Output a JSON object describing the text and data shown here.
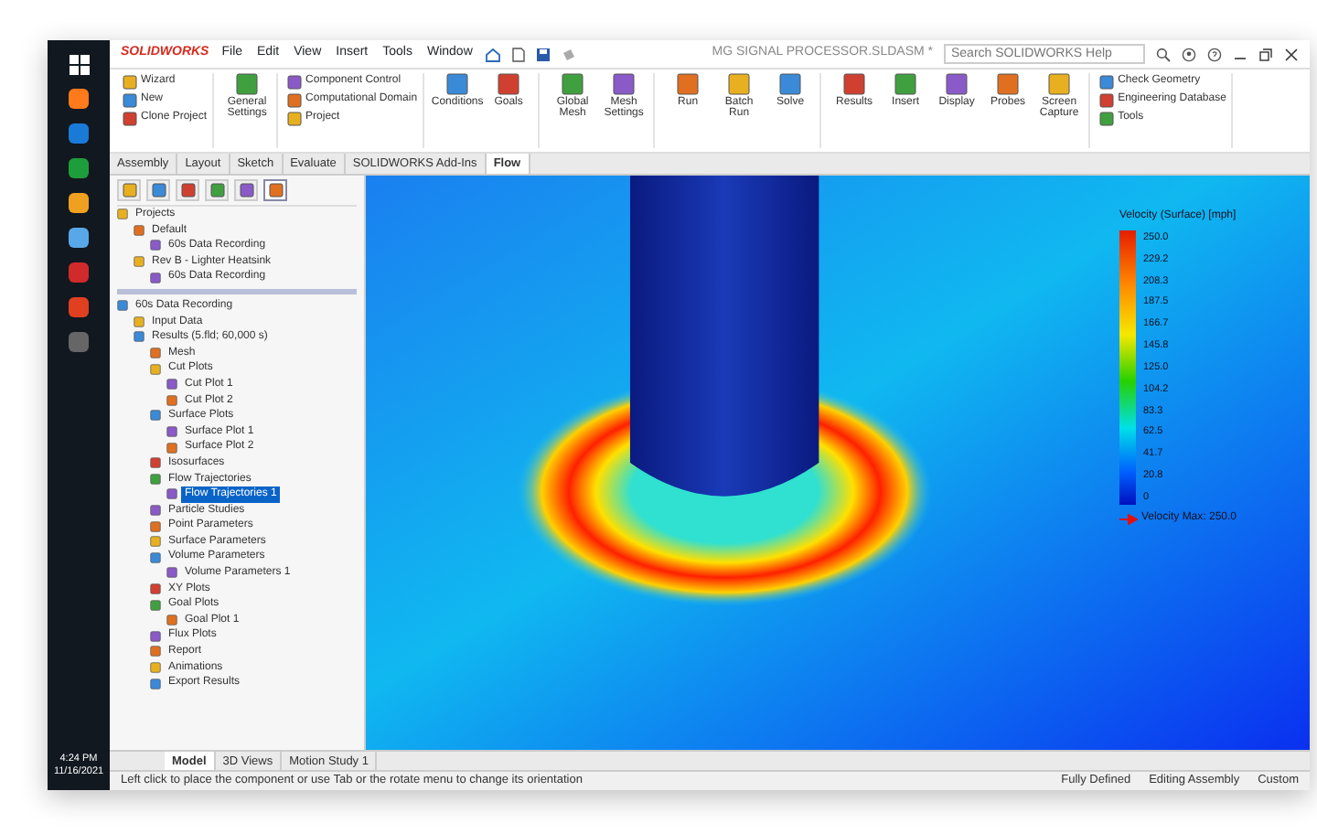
{
  "window": {
    "app_name": "SOLIDWORKS",
    "title": "MG SIGNAL PROCESSOR.SLDASM *",
    "menus": [
      "File",
      "Edit",
      "View",
      "Insert",
      "Tools",
      "Window"
    ],
    "search": {
      "placeholder": "Search SOLIDWORKS Help"
    }
  },
  "ribbon": [
    [
      {
        "kind": "small",
        "label": "Wizard"
      },
      {
        "kind": "small",
        "label": "New"
      },
      {
        "kind": "small",
        "label": "Clone Project"
      }
    ],
    [
      {
        "kind": "large",
        "label": "General Settings"
      }
    ],
    [
      {
        "kind": "small",
        "label": "Component Control"
      },
      {
        "kind": "small",
        "label": "Computational Domain"
      },
      {
        "kind": "small",
        "label": "Project"
      }
    ],
    [
      {
        "kind": "large",
        "label": "Conditions"
      },
      {
        "kind": "large",
        "label": "Goals"
      }
    ],
    [
      {
        "kind": "large",
        "label": "Global Mesh"
      },
      {
        "kind": "large",
        "label": "Mesh Settings"
      }
    ],
    [
      {
        "kind": "large",
        "label": "Run"
      },
      {
        "kind": "large",
        "label": "Batch Run"
      },
      {
        "kind": "large",
        "label": "Solve"
      }
    ],
    [
      {
        "kind": "large",
        "label": "Results"
      },
      {
        "kind": "large",
        "label": "Insert"
      },
      {
        "kind": "large",
        "label": "Display"
      },
      {
        "kind": "large",
        "label": "Probes"
      },
      {
        "kind": "large",
        "label": "Screen Capture"
      }
    ],
    [
      {
        "kind": "small",
        "label": "Check Geometry"
      },
      {
        "kind": "small",
        "label": "Engineering Database"
      },
      {
        "kind": "small",
        "label": "Tools"
      }
    ]
  ],
  "tabs": [
    {
      "label": "Assembly",
      "selected": false
    },
    {
      "label": "Layout",
      "selected": false
    },
    {
      "label": "Sketch",
      "selected": false
    },
    {
      "label": "Evaluate",
      "selected": false
    },
    {
      "label": "SOLIDWORKS Add-Ins",
      "selected": false
    },
    {
      "label": "Flow",
      "selected": true
    }
  ],
  "panel_tabs": [
    {
      "selected": false
    },
    {
      "selected": false
    },
    {
      "selected": false
    },
    {
      "selected": false
    },
    {
      "selected": false
    },
    {
      "selected": true
    }
  ],
  "project_tree": [
    {
      "label": "Projects",
      "selected": false,
      "children": [
        {
          "label": "Default",
          "selected": false,
          "children": [
            {
              "label": "60s Data Recording",
              "selected": false
            }
          ]
        },
        {
          "label": "Rev B - Lighter Heatsink",
          "selected": false,
          "children": [
            {
              "label": "60s Data Recording",
              "selected": false
            }
          ]
        }
      ]
    }
  ],
  "analysis_tree": [
    {
      "label": "60s Data Recording",
      "selected": false,
      "children": [
        {
          "label": "Input Data",
          "selected": false
        },
        {
          "label": "Results (5.fld; 60,000 s)",
          "selected": false,
          "children": [
            {
              "label": "Mesh",
              "selected": false
            },
            {
              "label": "Cut Plots",
              "selected": false,
              "children": [
                {
                  "label": "Cut Plot 1",
                  "selected": false
                },
                {
                  "label": "Cut Plot 2",
                  "selected": false
                }
              ]
            },
            {
              "label": "Surface Plots",
              "selected": false,
              "children": [
                {
                  "label": "Surface Plot 1",
                  "selected": false
                },
                {
                  "label": "Surface Plot 2",
                  "selected": false
                }
              ]
            },
            {
              "label": "Isosurfaces",
              "selected": false
            },
            {
              "label": "Flow Trajectories",
              "selected": false,
              "children": [
                {
                  "label": "Flow Trajectories 1",
                  "selected": true
                }
              ]
            },
            {
              "label": "Particle Studies",
              "selected": false
            },
            {
              "label": "Point Parameters",
              "selected": false
            },
            {
              "label": "Surface Parameters",
              "selected": false
            },
            {
              "label": "Volume Parameters",
              "selected": false,
              "children": [
                {
                  "label": "Volume Parameters 1",
                  "selected": false
                }
              ]
            },
            {
              "label": "XY Plots",
              "selected": false
            },
            {
              "label": "Goal Plots",
              "selected": false,
              "children": [
                {
                  "label": "Goal Plot 1",
                  "selected": false
                }
              ]
            },
            {
              "label": "Flux Plots",
              "selected": false
            },
            {
              "label": "Report",
              "selected": false
            },
            {
              "label": "Animations",
              "selected": false
            },
            {
              "label": "Export Results",
              "selected": false
            }
          ]
        }
      ]
    }
  ],
  "legend": {
    "title": "Velocity (Surface) [mph]",
    "ticks": [
      "250.0",
      "229.2",
      "208.3",
      "187.5",
      "166.7",
      "145.8",
      "125.0",
      "104.2",
      "83.3",
      "62.5",
      "41.7",
      "20.8",
      "0"
    ],
    "max_label": "Velocity Max: 250.0"
  },
  "bottom_tabs": [
    {
      "label": "Model",
      "selected": true
    },
    {
      "label": "3D Views",
      "selected": false
    },
    {
      "label": "Motion Study 1",
      "selected": false
    }
  ],
  "status_bar": {
    "message": "Left click to place the component or use Tab or the rotate menu to change its orientation",
    "items": [
      "Fully Defined",
      "Editing Assembly",
      "Custom"
    ]
  },
  "taskbar": {
    "time": "4:24 PM",
    "date": "11/16/2021"
  }
}
